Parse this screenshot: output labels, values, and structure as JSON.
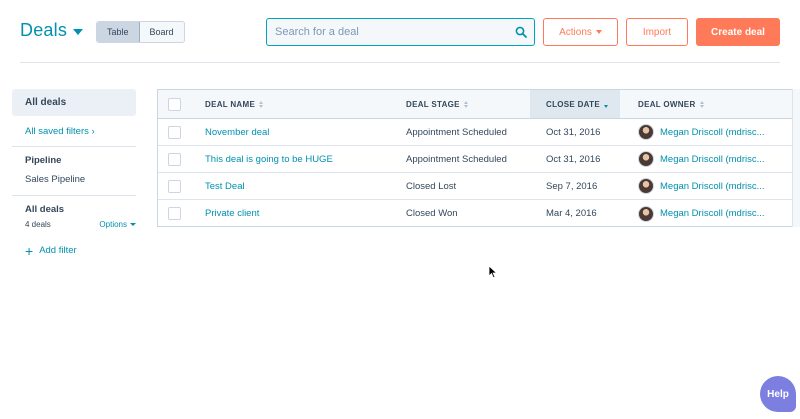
{
  "header": {
    "title": "Deals",
    "view_toggle": [
      "Table",
      "Board"
    ],
    "active_view": "Table",
    "search_placeholder": "Search for a deal",
    "actions_label": "Actions",
    "import_label": "Import",
    "create_label": "Create deal"
  },
  "sidebar": {
    "all_deals": "All deals",
    "saved_filters": "All saved filters",
    "pipeline_label": "Pipeline",
    "pipeline_value": "Sales Pipeline",
    "view_name": "All deals",
    "deal_count": "4 deals",
    "options_label": "Options",
    "add_filter": "Add filter"
  },
  "table": {
    "columns": [
      "DEAL NAME",
      "DEAL STAGE",
      "CLOSE DATE",
      "DEAL OWNER"
    ],
    "sorted_column": "CLOSE DATE",
    "rows": [
      {
        "name": "November deal",
        "stage": "Appointment Scheduled",
        "close_date": "Oct 31, 2016",
        "owner": "Megan Driscoll (mdrisc..."
      },
      {
        "name": "This deal is going to be HUGE",
        "stage": "Appointment Scheduled",
        "close_date": "Oct 31, 2016",
        "owner": "Megan Driscoll (mdrisc..."
      },
      {
        "name": "Test Deal",
        "stage": "Closed Lost",
        "close_date": "Sep 7, 2016",
        "owner": "Megan Driscoll (mdrisc..."
      },
      {
        "name": "Private client",
        "stage": "Closed Won",
        "close_date": "Mar 4, 2016",
        "owner": "Megan Driscoll (mdrisc..."
      }
    ]
  },
  "help_label": "Help",
  "colors": {
    "accent": "#0091ae",
    "primary_button": "#ff7a59",
    "text": "#33475b",
    "help_bubble": "#7c7fe0"
  },
  "icons": [
    "chevron-down-icon",
    "search-icon",
    "chevron-right-icon",
    "plus-icon",
    "sort-icon",
    "avatar",
    "cursor-icon"
  ]
}
